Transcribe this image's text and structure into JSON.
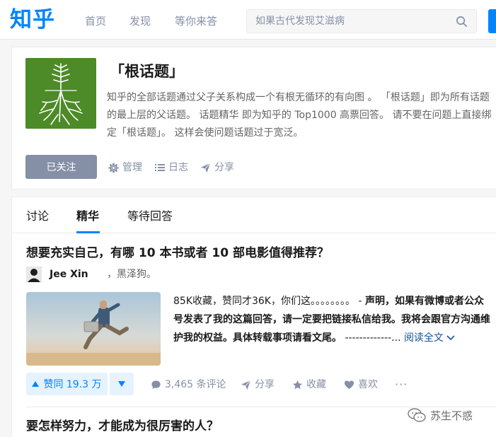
{
  "header": {
    "logo": "知乎",
    "nav": [
      "首页",
      "发现",
      "等你来答"
    ],
    "search_placeholder": "如果古代发现艾滋病"
  },
  "topic": {
    "title": "「根话题」",
    "description": "知乎的全部话题通过父子关系构成一个有根无循环的有向图 。 「根话题」即为所有话题的最上层的父话题。 话题精华 即为知乎的 Top1000 高票回答。 请不要在问题上直接绑定「根话题」。 这样会使问题话题过于宽泛。",
    "follow_label": "已关注",
    "actions": {
      "manage": "管理",
      "log": "日志",
      "share": "分享"
    }
  },
  "tabs": [
    "讨论",
    "精华",
    "等待回答"
  ],
  "feed": [
    {
      "question": "想要充实自己，有哪 10 本书或者 10 部电影值得推荐？",
      "author": "Jee Xin",
      "bio": "，黑泽狗。",
      "excerpt_plain": "85K收藏，赞同才36K，你们这。。。。。。。。 - ",
      "excerpt_bold": "声明，如果有微博或者公众号发表了我的这篇回答，请一定要把链接私信给我。我将会跟官方沟通维护我的权益。具体转载事项请看文尾。",
      "excerpt_tail": " -------------...",
      "read_more": "阅读全文",
      "vote": "赞同 19.3 万",
      "comments": "3,465 条评论",
      "share": "分享",
      "collect": "收藏",
      "like": "喜欢",
      "more": "···"
    },
    {
      "question": "要怎样努力，才能成为很厉害的人？"
    }
  ],
  "watermark": "苏生不惑",
  "colors": {
    "brand": "#0084ff",
    "muted": "#8590a6",
    "topic_green": "#4d8a28"
  }
}
